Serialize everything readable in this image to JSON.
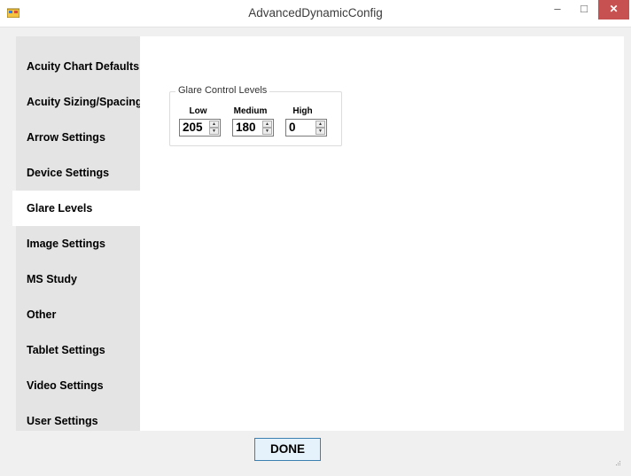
{
  "window": {
    "title": "AdvancedDynamicConfig",
    "minimize_glyph": "–",
    "maximize_glyph": "□",
    "close_glyph": "✕"
  },
  "tabs": [
    {
      "label": "Acuity Chart Defaults",
      "selected": false
    },
    {
      "label": "Acuity Sizing/Spacing",
      "selected": false
    },
    {
      "label": "Arrow Settings",
      "selected": false
    },
    {
      "label": "Device Settings",
      "selected": false
    },
    {
      "label": "Glare Levels",
      "selected": true
    },
    {
      "label": "Image Settings",
      "selected": false
    },
    {
      "label": "MS Study",
      "selected": false
    },
    {
      "label": "Other",
      "selected": false
    },
    {
      "label": "Tablet Settings",
      "selected": false
    },
    {
      "label": "Video Settings",
      "selected": false
    },
    {
      "label": "User Settings",
      "selected": false
    }
  ],
  "glare_group": {
    "title": "Glare Control Levels",
    "low": {
      "label": "Low",
      "value": "205"
    },
    "medium": {
      "label": "Medium",
      "value": "180"
    },
    "high": {
      "label": "High",
      "value": "0"
    }
  },
  "footer": {
    "done_label": "DONE"
  },
  "colors": {
    "close_button": "#c75050",
    "tab_strip": "#e4e4e4",
    "selected_tab": "#ffffff",
    "done_border": "#3c7fb1"
  }
}
